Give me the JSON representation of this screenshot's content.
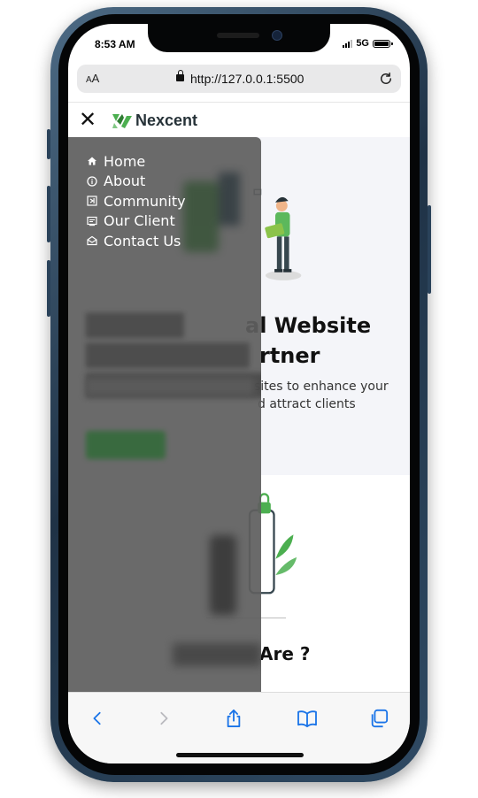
{
  "status_bar": {
    "time": "8:53 AM",
    "network": "5G"
  },
  "browser": {
    "text_size_label": "AA",
    "url": "http://127.0.0.1:5500",
    "reload_icon": "reload-icon"
  },
  "navbar": {
    "brand": "Nexcent",
    "close_icon": "close-icon"
  },
  "menu": {
    "items": [
      {
        "label": "Home",
        "icon": "home-icon"
      },
      {
        "label": "About",
        "icon": "info-icon"
      },
      {
        "label": "Community",
        "icon": "community-icon"
      },
      {
        "label": "Our Client",
        "icon": "client-icon"
      },
      {
        "label": "Contact Us",
        "icon": "mail-icon"
      }
    ]
  },
  "hero": {
    "title": "Your Professional Website Development Partner",
    "visible_title_1": "al Website",
    "visible_title_2": "rtner",
    "visible_desc_1": "sites to enhance your",
    "visible_desc_2": "d attract clients"
  },
  "section2": {
    "visible_title": "Are ?"
  },
  "toolbar": {
    "items": [
      "back-icon",
      "forward-icon",
      "share-icon",
      "bookmarks-icon",
      "tabs-icon"
    ]
  },
  "colors": {
    "accent": "#4caf50",
    "ios_blue": "#1a74e8",
    "drawer": "#5f5f5f"
  }
}
